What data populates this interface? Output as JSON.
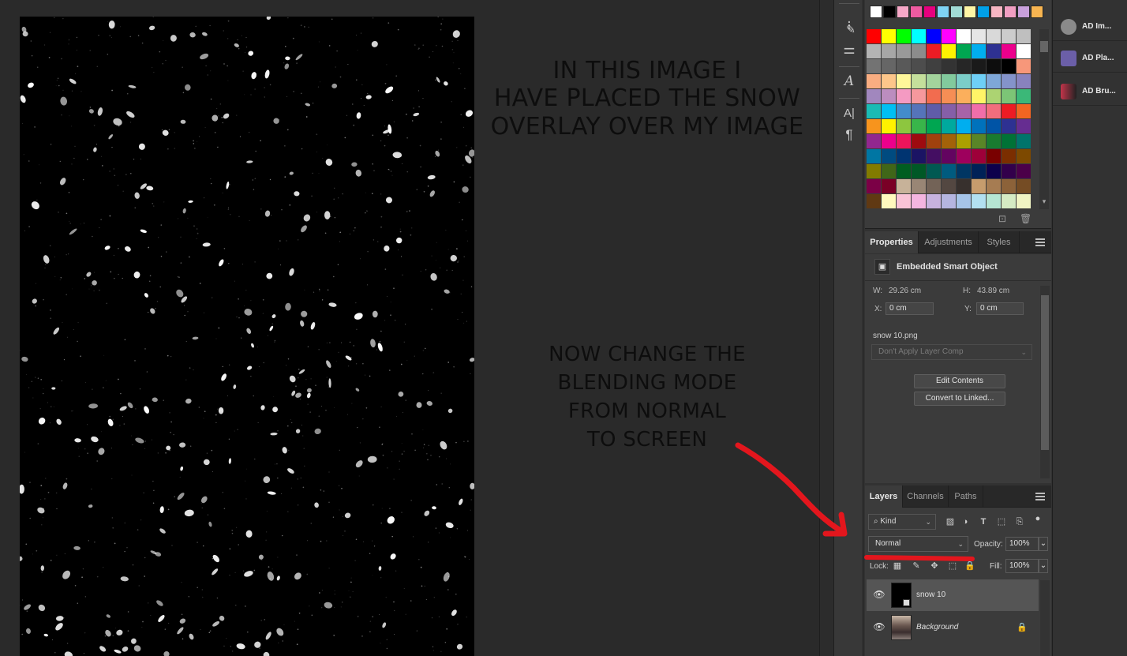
{
  "annotations": {
    "top_lines": [
      "IN THIS IMAGE I",
      "HAVE PLACED THE SNOW",
      "OVERLAY OVER MY IMAGE"
    ],
    "bottom_lines": [
      "NOW CHANGE THE",
      "BLENDING MODE",
      "FROM NORMAL",
      "TO SCREEN"
    ]
  },
  "colors": {
    "annotation_red": "#e3161d",
    "panel_bg": "#3b3b3b",
    "selected_layer": "#555555"
  },
  "tools": [
    {
      "icon": "brush-settings-icon",
      "glyph": "⁝"
    },
    {
      "icon": "brush-presets-icon",
      "glyph": "✎"
    },
    {
      "icon": "adjustment-sliders-icon",
      "glyph": "⚌"
    },
    {
      "icon": "character-icon",
      "glyph": "A"
    },
    {
      "icon": "character-styles-icon",
      "glyph": "A|"
    },
    {
      "icon": "paragraph-icon",
      "glyph": "¶"
    }
  ],
  "swatches": {
    "recent": [
      "#ffffff",
      "#000000",
      "#f7a8c8",
      "#ef5ba1",
      "#e6007e",
      "#7fd3f4",
      "#a2dcd6",
      "#fff5a5",
      "#00a0e9",
      "#f7b6c3",
      "#f19ec2",
      "#c9a0dc",
      "#f8b551"
    ],
    "grid": [
      "#ff0000",
      "#ffff00",
      "#00ff00",
      "#00ffff",
      "#0000ff",
      "#ff00ff",
      "#ffffff",
      "#e6e6e6",
      "#d9d9d9",
      "#cccccc",
      "#bfbfbf",
      "#b3b3b3",
      "#a6a6a6",
      "#999999",
      "#8c8c8c",
      "#ed1c24",
      "#fff200",
      "#00a651",
      "#00aeef",
      "#2e3192",
      "#ec008c",
      "#ffffff",
      "#737373",
      "#666666",
      "#595959",
      "#4d4d4d",
      "#404040",
      "#333333",
      "#262626",
      "#1a1a1a",
      "#0d0d0d",
      "#000000",
      "#f7977a",
      "#f9ad81",
      "#fdc68a",
      "#fff79a",
      "#c4df9b",
      "#a3d39c",
      "#82ca9d",
      "#7bcdc8",
      "#6ecff6",
      "#7ea7d8",
      "#8493ca",
      "#8882be",
      "#a187be",
      "#bc8dbf",
      "#f49ac2",
      "#f6989d",
      "#f26c4f",
      "#f68e55",
      "#fbaf5c",
      "#fff467",
      "#acd372",
      "#7cc576",
      "#3bb878",
      "#1abbb4",
      "#00bff3",
      "#438ccb",
      "#5574b9",
      "#605ca8",
      "#855fa8",
      "#a763a8",
      "#f06ea9",
      "#f26d7d",
      "#ed1c24",
      "#f26522",
      "#f7941d",
      "#fff200",
      "#8dc63f",
      "#39b54a",
      "#00a651",
      "#00a99d",
      "#00aeef",
      "#0072bc",
      "#0054a6",
      "#2e3192",
      "#662d91",
      "#92278f",
      "#ec008c",
      "#ed145b",
      "#9e0b0f",
      "#a0410d",
      "#a36209",
      "#aba000",
      "#598527",
      "#197b30",
      "#007236",
      "#00746b",
      "#0076a3",
      "#004b80",
      "#003471",
      "#1b1464",
      "#440e62",
      "#630460",
      "#9e005d",
      "#9e0039",
      "#790000",
      "#7b2e00",
      "#7d4900",
      "#827b00",
      "#406618",
      "#005e20",
      "#005826",
      "#005952",
      "#005b7f",
      "#003663",
      "#002157",
      "#0d004c",
      "#32004b",
      "#4b0049",
      "#7b0046",
      "#7a0026",
      "#c7b299",
      "#998675",
      "#736357",
      "#534741",
      "#37302d",
      "#c69c6d",
      "#a67c52",
      "#8c6239",
      "#754c24",
      "#603913",
      "#fff9bd",
      "#f9c3d6",
      "#f4b5e0",
      "#c7b2de",
      "#b5b5e0",
      "#a6c4e8",
      "#b2e0f0",
      "#b5e6d3",
      "#d5ebc3",
      "#f0f4c3",
      "#fce4ec",
      "#e1bee7",
      "#d1c4e9",
      "#bbdefb",
      "#b2ebf2",
      "#c8e6c9",
      "#fff9c4",
      "#ffe0b2",
      "#cfd8dc",
      "#d7ccc8",
      "#f5f5f5",
      "#eeeeee",
      "#e0e0e0",
      "#e8eaf6",
      "#e3f2fd",
      "#e0f7fa",
      "#e8f5e9",
      "#f1f8e9",
      "#fffde7",
      "#fff3e0",
      "#fbe9e7",
      "#efebe9"
    ]
  },
  "properties": {
    "tabs": [
      "Properties",
      "Adjustments",
      "Styles"
    ],
    "object_type": "Embedded Smart Object",
    "w_label": "W:",
    "w_value": "29.26 cm",
    "h_label": "H:",
    "h_value": "43.89 cm",
    "x_label": "X:",
    "x_value": "0 cm",
    "y_label": "Y:",
    "y_value": "0 cm",
    "file_name": "snow 10.png",
    "layer_comp_placeholder": "Don't Apply Layer Comp",
    "edit_contents": "Edit Contents",
    "convert_linked": "Convert to Linked..."
  },
  "layers": {
    "tabs": [
      "Layers",
      "Channels",
      "Paths"
    ],
    "kind": "Kind",
    "filter_icons": [
      "image-filter-icon",
      "adjustment-filter-icon",
      "type-filter-icon",
      "shape-filter-icon",
      "smart-object-filter-icon"
    ],
    "blend_mode": "Normal",
    "opacity_label": "Opacity:",
    "opacity_value": "100%",
    "lock_label": "Lock:",
    "fill_label": "Fill:",
    "fill_value": "100%",
    "items": [
      {
        "name": "snow 10",
        "selected": true,
        "italic": false
      },
      {
        "name": "Background",
        "selected": false,
        "italic": true
      }
    ]
  },
  "side_panels": [
    {
      "label": "AD Im...",
      "icon": "ad-image-icon",
      "color": "#8a8a8a"
    },
    {
      "label": "AD Pla...",
      "icon": "ad-place-icon",
      "color": "#6b5fa8"
    },
    {
      "label": "AD Bru...",
      "icon": "ad-brush-icon",
      "color": "#c2344a"
    }
  ]
}
